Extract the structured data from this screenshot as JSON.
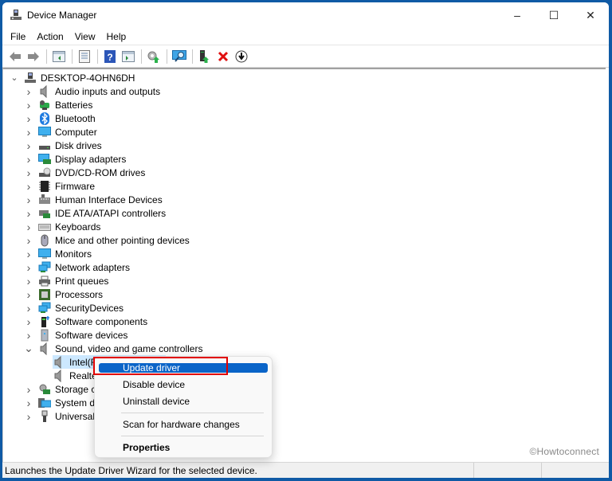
{
  "window": {
    "title": "Device Manager",
    "controls": {
      "minimize": "–",
      "maximize": "☐",
      "close": "✕"
    }
  },
  "menubar": [
    "File",
    "Action",
    "View",
    "Help"
  ],
  "toolbar": [
    {
      "name": "back-icon",
      "glyph": "⇦"
    },
    {
      "name": "forward-icon",
      "glyph": "⇨"
    },
    {
      "name": "show-hide-console-tree-icon",
      "glyph": "▤"
    },
    {
      "name": "properties-icon",
      "glyph": "▦"
    },
    {
      "name": "help-icon",
      "glyph": "?"
    },
    {
      "name": "show-action-pane-icon",
      "glyph": "▥"
    },
    {
      "name": "update-driver-icon",
      "glyph": "⚙"
    },
    {
      "name": "scan-hardware-icon",
      "glyph": "🖵"
    },
    {
      "name": "enable-device-icon",
      "glyph": "▮"
    },
    {
      "name": "uninstall-device-icon",
      "glyph": "✕"
    },
    {
      "name": "download-driver-icon",
      "glyph": "⬇"
    }
  ],
  "tree": {
    "root": "DESKTOP-4OHN6DH",
    "categories": [
      {
        "label": "Audio inputs and outputs",
        "icon": "speaker"
      },
      {
        "label": "Batteries",
        "icon": "battery"
      },
      {
        "label": "Bluetooth",
        "icon": "bluetooth"
      },
      {
        "label": "Computer",
        "icon": "monitor"
      },
      {
        "label": "Disk drives",
        "icon": "disk"
      },
      {
        "label": "Display adapters",
        "icon": "display-adapter"
      },
      {
        "label": "DVD/CD-ROM drives",
        "icon": "dvd"
      },
      {
        "label": "Firmware",
        "icon": "chip"
      },
      {
        "label": "Human Interface Devices",
        "icon": "hid"
      },
      {
        "label": "IDE ATA/ATAPI controllers",
        "icon": "ide"
      },
      {
        "label": "Keyboards",
        "icon": "keyboard"
      },
      {
        "label": "Mice and other pointing devices",
        "icon": "mouse"
      },
      {
        "label": "Monitors",
        "icon": "monitor"
      },
      {
        "label": "Network adapters",
        "icon": "network"
      },
      {
        "label": "Print queues",
        "icon": "printer"
      },
      {
        "label": "Processors",
        "icon": "processor"
      },
      {
        "label": "SecurityDevices",
        "icon": "network"
      },
      {
        "label": "Software components",
        "icon": "software-component"
      },
      {
        "label": "Software devices",
        "icon": "software-device"
      },
      {
        "label": "Sound, video and game controllers",
        "icon": "speaker",
        "expanded": true,
        "children": [
          {
            "label": "Intel(R) Display Audio",
            "selected": true
          },
          {
            "label": "Realtek"
          }
        ]
      },
      {
        "label": "Storage co",
        "icon": "storage"
      },
      {
        "label": "System dev",
        "icon": "system"
      },
      {
        "label": "Universal S",
        "icon": "usb"
      }
    ]
  },
  "context_menu": {
    "items": [
      "Update driver",
      "Disable device",
      "Uninstall device",
      "Scan for hardware changes",
      "Properties"
    ],
    "highlighted": "Update driver"
  },
  "statusbar": {
    "text": "Launches the Update Driver Wizard for the selected device."
  },
  "watermark": "©Howtoconnect",
  "colors": {
    "accent": "#0a64c8",
    "highlight_box": "#e10000",
    "desktop": "#0f5aa5",
    "selection": "#cce8ff"
  }
}
